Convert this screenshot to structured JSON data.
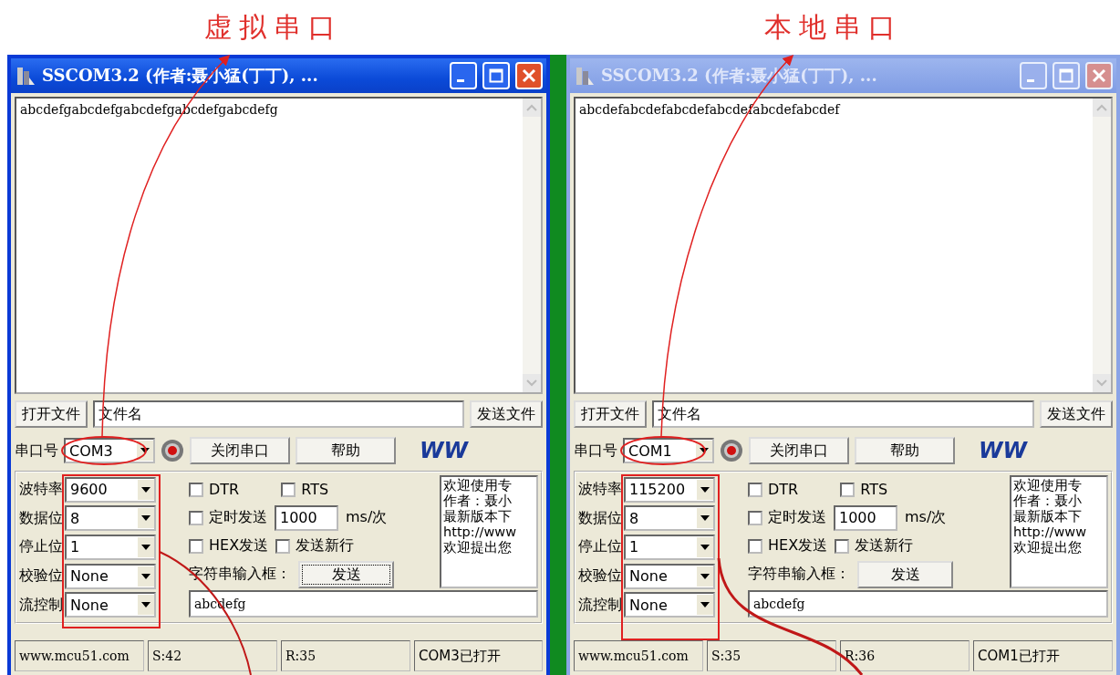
{
  "annotations": [
    {
      "label": "虚拟串口"
    },
    {
      "label": "本地串口"
    }
  ],
  "windows": [
    {
      "title": "SSCOM3.2 (作者:聂小猛(丁丁), ...",
      "active": true,
      "receive_text": "abcdefgabcdefgabcdefgabcdefgabcdefg",
      "open_file_button": "打开文件",
      "file_name": "文件名",
      "send_file_button": "发送文件",
      "port_label": "串口号",
      "port": "COM3",
      "close_port_button": "关闭串口",
      "help_button": "帮助",
      "logo": "WW",
      "settings": [
        {
          "label": "波特率",
          "value": "9600"
        },
        {
          "label": "数据位",
          "value": "8"
        },
        {
          "label": "停止位",
          "value": "1"
        },
        {
          "label": "校验位",
          "value": "None"
        },
        {
          "label": "流控制",
          "value": "None"
        }
      ],
      "checkboxes": [
        {
          "label": "DTR",
          "checked": false
        },
        {
          "label": "RTS",
          "checked": false
        },
        {
          "label": "定时发送",
          "checked": false
        },
        {
          "label": "HEX发送",
          "checked": false
        },
        {
          "label": "发送新行",
          "checked": false
        }
      ],
      "interval": "1000",
      "interval_unit": "ms/次",
      "input_label": "字符串输入框：",
      "send_button": "发送",
      "send_focused": true,
      "input_value": "abcdefg",
      "info_lines": [
        "欢迎使用专",
        "作者：聂小",
        "最新版本下",
        "http://www",
        "欢迎提出您"
      ],
      "status": [
        "www.mcu51.com",
        "S:42",
        "R:35",
        "COM3已打开"
      ]
    },
    {
      "title": "SSCOM3.2 (作者:聂小猛(丁丁), ...",
      "active": false,
      "receive_text": "abcdefabcdefabcdefabcdefabcdefabcdef",
      "open_file_button": "打开文件",
      "file_name": "文件名",
      "send_file_button": "发送文件",
      "port_label": "串口号",
      "port": "COM1",
      "close_port_button": "关闭串口",
      "help_button": "帮助",
      "logo": "WW",
      "settings": [
        {
          "label": "波特率",
          "value": "115200"
        },
        {
          "label": "数据位",
          "value": "8"
        },
        {
          "label": "停止位",
          "value": "1"
        },
        {
          "label": "校验位",
          "value": "None"
        },
        {
          "label": "流控制",
          "value": "None"
        }
      ],
      "checkboxes": [
        {
          "label": "DTR",
          "checked": false
        },
        {
          "label": "RTS",
          "checked": false
        },
        {
          "label": "定时发送",
          "checked": false
        },
        {
          "label": "HEX发送",
          "checked": false
        },
        {
          "label": "发送新行",
          "checked": false
        }
      ],
      "interval": "1000",
      "interval_unit": "ms/次",
      "input_label": "字符串输入框：",
      "send_button": "发送",
      "send_focused": false,
      "input_value": "abcdefg",
      "info_lines": [
        "欢迎使用专",
        "作者：聂小",
        "最新版本下",
        "http://www",
        "欢迎提出您"
      ],
      "status": [
        "www.mcu51.com",
        "S:35",
        "R:36",
        "COM1已打开"
      ]
    }
  ]
}
